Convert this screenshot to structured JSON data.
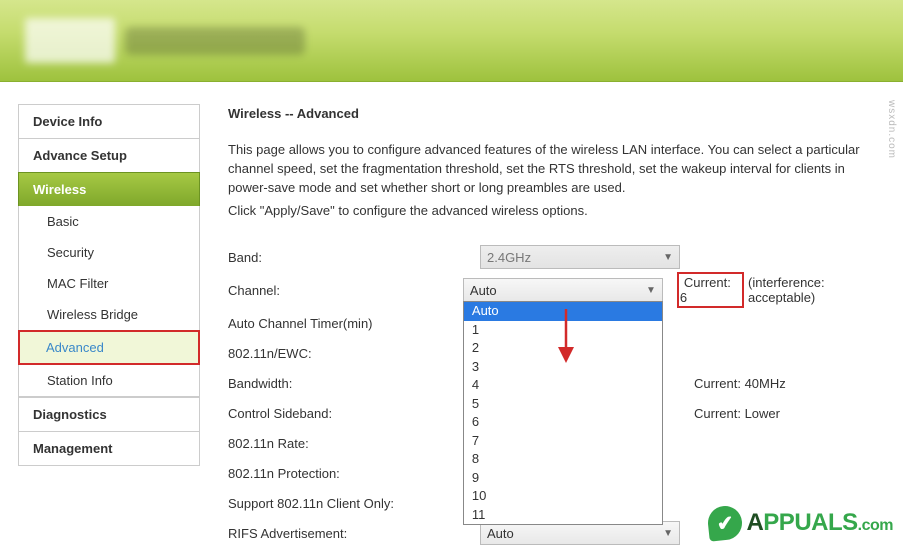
{
  "sidebar": {
    "device_info": "Device Info",
    "advance_setup": "Advance Setup",
    "wireless": "Wireless",
    "basic": "Basic",
    "security": "Security",
    "mac_filter": "MAC Filter",
    "wireless_bridge": "Wireless Bridge",
    "advanced": "Advanced",
    "station_info": "Station Info",
    "diagnostics": "Diagnostics",
    "management": "Management"
  },
  "page": {
    "title_prefix": "Wireless",
    "title_sep": " -- ",
    "title_suffix": "Advanced",
    "desc1": "This page allows you to configure advanced features of the wireless LAN interface. You can select a particular channel speed, set the fragmentation threshold, set the RTS threshold, set the wakeup interval for clients in power-save mode and set whether short or long preambles are used.",
    "desc2": "Click \"Apply/Save\" to configure the advanced wireless options."
  },
  "form": {
    "band_label": "Band:",
    "band_value": "2.4GHz",
    "channel_label": "Channel:",
    "channel_value": "Auto",
    "channel_current_label": "Current: 6",
    "channel_current_extra": "(interference: acceptable)",
    "channel_options": [
      "Auto",
      "1",
      "2",
      "3",
      "4",
      "5",
      "6",
      "7",
      "8",
      "9",
      "10",
      "11"
    ],
    "auto_timer_label": "Auto Channel Timer(min)",
    "ewc_label": "802.11n/EWC:",
    "bandwidth_label": "Bandwidth:",
    "bandwidth_current": "Current: 40MHz",
    "sideband_label": "Control Sideband:",
    "sideband_current": "Current: Lower",
    "rate_label": "802.11n Rate:",
    "protection_label": "802.11n Protection:",
    "client_only_label": "Support 802.11n Client Only:",
    "rifs_label": "RIFS Advertisement:",
    "rifs_value": "Auto"
  },
  "watermark": {
    "brand": "PPUALS",
    "brand_accent_index": 0,
    "suffix": ".com"
  },
  "attribution": "wsxdn.com"
}
